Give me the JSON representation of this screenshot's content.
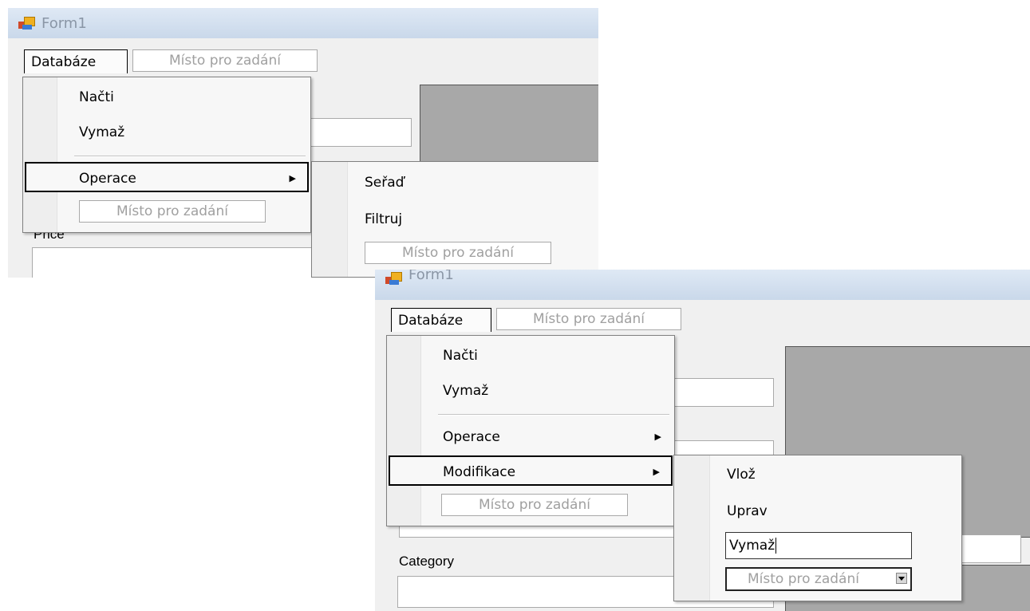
{
  "shot1": {
    "window_title": "Form1",
    "menu": {
      "top_item": "Databáze",
      "type_here": "Místo pro zadání"
    },
    "dropdown": {
      "items": [
        {
          "label": "Načti"
        },
        {
          "label": "Vymaž"
        },
        {
          "label": "Operace",
          "has_submenu": true,
          "selected": true
        }
      ],
      "type_here": "Místo pro zadání"
    },
    "submenu": {
      "items": [
        "Seřaď",
        "Filtruj"
      ],
      "type_here": "Místo pro zadání"
    },
    "field_label_partial": "Price"
  },
  "shot2": {
    "window_title": "Form1",
    "menu": {
      "top_item": "Databáze",
      "type_here": "Místo pro zadání"
    },
    "dropdown": {
      "items": [
        {
          "label": "Načti"
        },
        {
          "label": "Vymaž"
        },
        {
          "label": "Operace",
          "has_submenu": true
        },
        {
          "label": "Modifikace",
          "has_submenu": true,
          "selected": true
        }
      ],
      "type_here": "Místo pro zadání"
    },
    "submenu": {
      "items": [
        "Vlož",
        "Uprav"
      ],
      "editing_value": "Vymaž",
      "type_here_combo": "Místo pro zadání"
    },
    "field_label": "Category"
  },
  "colors": {
    "form_bg": "#f0f0f0",
    "picturebox": "#a8a8a8",
    "disabled_text": "#a0a0a0"
  }
}
